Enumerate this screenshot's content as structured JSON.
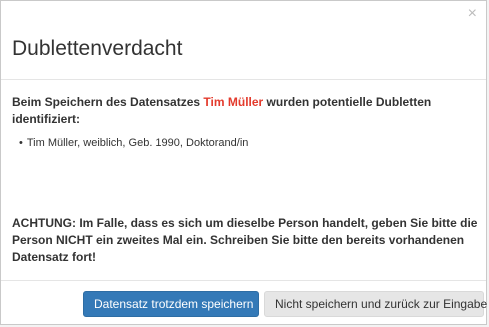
{
  "dialog": {
    "title": "Dublettenverdacht",
    "close_symbol": "×"
  },
  "body": {
    "intro_before": "Beim Speichern des Datensatzes ",
    "record_name": "Tim Müller",
    "intro_after": " wurden potentielle Dubletten identifiziert:",
    "duplicates": [
      "Tim Müller, weiblich, Geb. 1990, Doktorand/in"
    ],
    "warning": "ACHTUNG: Im Falle, dass es sich um dieselbe Person handelt, geben Sie bitte die Person NICHT ein zweites Mal ein. Schreiben Sie bitte den bereits vorhandenen Datensatz fort!"
  },
  "footer": {
    "save_anyway_label": "Datensatz trotzdem speichern",
    "dont_save_label": "Nicht speichern und zurück zur Eingabe"
  },
  "colors": {
    "primary": "#3479b7",
    "highlight_name": "#e33a2c"
  }
}
